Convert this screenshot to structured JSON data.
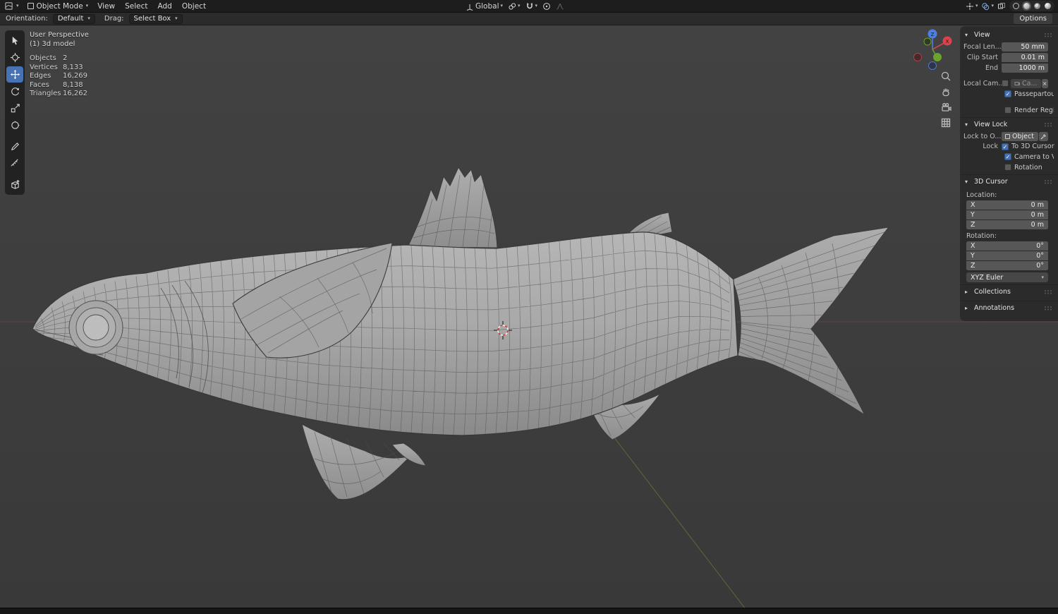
{
  "header": {
    "editor_type": "3D Viewport",
    "mode_label": "Object Mode",
    "menus": [
      {
        "label": "View"
      },
      {
        "label": "Select"
      },
      {
        "label": "Add"
      },
      {
        "label": "Object"
      }
    ],
    "transform_orientation": "Global",
    "options_label": "Options"
  },
  "tool_settings": {
    "orientation_label": "Orientation:",
    "orientation_value": "Default",
    "drag_label": "Drag:",
    "drag_value": "Select Box"
  },
  "hud": {
    "title": "User Perspective",
    "subtitle": "(1) 3d model",
    "stats": [
      {
        "label": "Objects",
        "value": "2"
      },
      {
        "label": "Vertices",
        "value": "8,133"
      },
      {
        "label": "Edges",
        "value": "16,269"
      },
      {
        "label": "Faces",
        "value": "8,138"
      },
      {
        "label": "Triangles",
        "value": "16,262"
      }
    ]
  },
  "gizmo": {
    "x_label": "X",
    "z_label": "Z"
  },
  "sidebar": {
    "view": {
      "title": "View",
      "rows": [
        {
          "label": "Focal Len...",
          "value": "50 mm"
        },
        {
          "label": "Clip Start",
          "value": "0.01 m"
        },
        {
          "label": "End",
          "value": "1000 m"
        }
      ],
      "local_camera": {
        "label": "Local Cam...",
        "value": "Ca...",
        "checked": false
      },
      "passepartout": {
        "label": "Passepartout",
        "checked": true
      },
      "render_region": {
        "label": "Render Regi...",
        "checked": false
      }
    },
    "view_lock": {
      "title": "View Lock",
      "lock_to_object_label": "Lock to O...",
      "object_value": "Object",
      "lock_label": "Lock",
      "checks": [
        {
          "label": "To 3D Cursor",
          "checked": true
        },
        {
          "label": "Camera to Vi...",
          "checked": true
        },
        {
          "label": "Rotation",
          "checked": false
        }
      ]
    },
    "cursor3d": {
      "title": "3D Cursor",
      "location_label": "Location:",
      "rotation_label": "Rotation:",
      "location": [
        {
          "axis": "X",
          "value": "0 m"
        },
        {
          "axis": "Y",
          "value": "0 m"
        },
        {
          "axis": "Z",
          "value": "0 m"
        }
      ],
      "rotation": [
        {
          "axis": "X",
          "value": "0°"
        },
        {
          "axis": "Y",
          "value": "0°"
        },
        {
          "axis": "Z",
          "value": "0°"
        }
      ],
      "euler": "XYZ Euler"
    },
    "collections": {
      "title": "Collections"
    },
    "annotations": {
      "title": "Annotations"
    }
  },
  "colors": {
    "accent": "#4772b3",
    "axis_x": "#c8444c",
    "axis_y": "#6f9e2f",
    "axis_z": "#4d7fe0"
  }
}
